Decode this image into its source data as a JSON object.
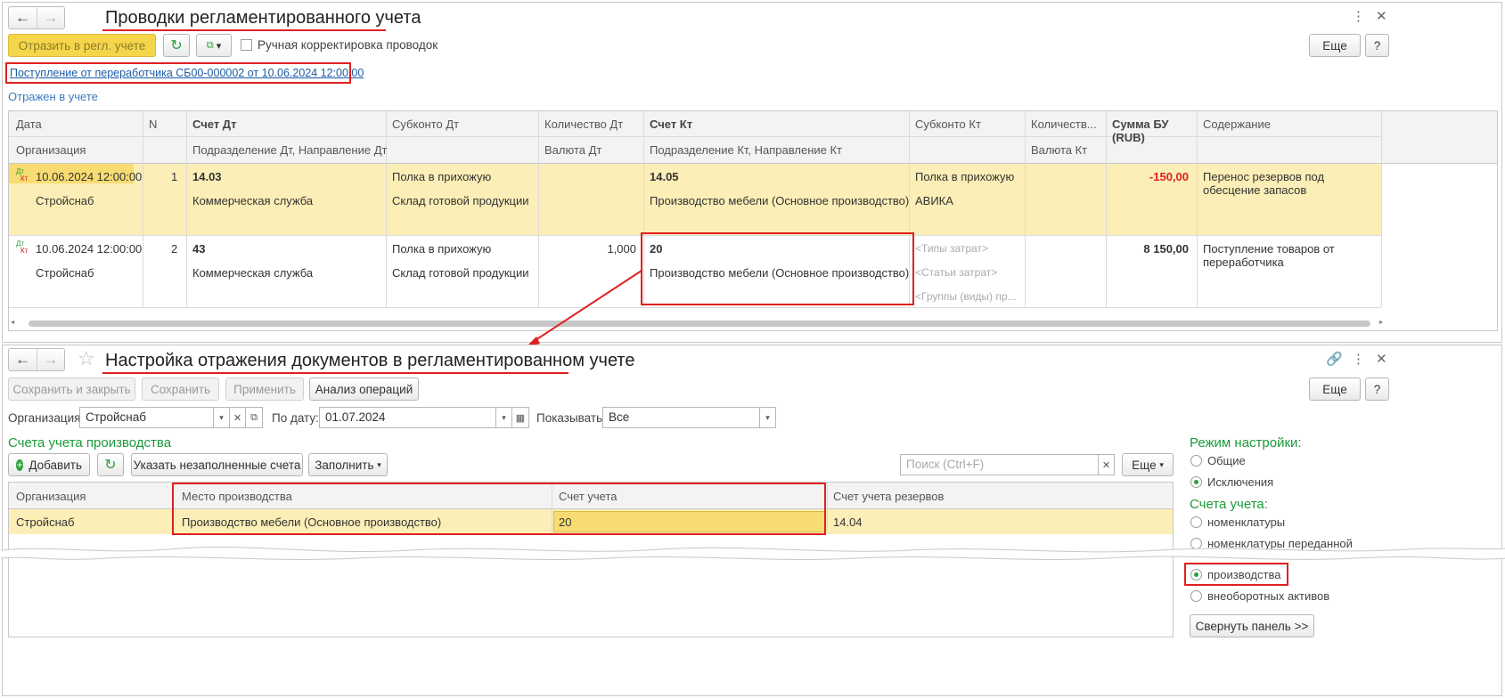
{
  "top": {
    "title": "Проводки регламентированного учета",
    "reflect_button": "Отразить в регл. учете",
    "manual_label": "Ручная корректировка проводок",
    "more_button": "Еще",
    "help_button": "?",
    "doc_link": "Поступление от переработчика СБ00-000002 от 10.06.2024 12:00:00",
    "status": "Отражен в учете",
    "headers": {
      "date": "Дата",
      "n": "N",
      "acc_dt": "Счет Дт",
      "sub_dt": "Субконто Дт",
      "qty_dt": "Количество Дт",
      "acc_kt": "Счет Кт",
      "sub_kt": "Субконто Кт",
      "qty_kt": "Количеств...",
      "sum": "Сумма БУ\n(RUB)",
      "content": "Содержание",
      "org": "Организация",
      "dept_dt": "Подразделение Дт, Направление Дт",
      "cur_dt": "Валюта Дт",
      "dept_kt": "Подразделение Кт, Направление Кт",
      "cur_kt": "Валюта Кт"
    },
    "rows": [
      {
        "dt": "Дт",
        "kt": "Кт",
        "date": "10.06.2024 12:00:00",
        "n": "1",
        "org": "Стройснаб",
        "acc_dt": "14.03",
        "dept_dt": "Коммерческая служба",
        "sub_dt1": "Полка в прихожую",
        "sub_dt2": "Склад готовой продукции",
        "qty_dt": "",
        "acc_kt": "14.05",
        "dept_kt": "Производство мебели (Основное производство)",
        "sub_kt1": "Полка в прихожую",
        "sub_kt2": "АВИКА",
        "sub_kt3": "",
        "sum": "-150,00",
        "content": "Перенос резервов под\nобесцение запасов"
      },
      {
        "dt": "Дт",
        "kt": "Кт",
        "date": "10.06.2024 12:00:00",
        "n": "2",
        "org": "Стройснаб",
        "acc_dt": "43",
        "dept_dt": "Коммерческая служба",
        "sub_dt1": "Полка в прихожую",
        "sub_dt2": "Склад готовой продукции",
        "qty_dt": "1,000",
        "acc_kt": "20",
        "dept_kt": "Производство мебели (Основное производство)",
        "sub_kt1": "<Типы затрат>",
        "sub_kt2": "<Статьи затрат>",
        "sub_kt3": "<Группы (виды) пр...",
        "sum": "8 150,00",
        "content": "Поступление товаров от\nпереработчика"
      }
    ]
  },
  "bottom": {
    "title": "Настройка отражения документов в регламентированном учете",
    "save_close": "Сохранить и закрыть",
    "save": "Сохранить",
    "apply": "Применить",
    "analysis": "Анализ операций",
    "more_button": "Еще",
    "help_button": "?",
    "org_label": "Организация:",
    "org_value": "Стройснаб",
    "date_label": "По дату:",
    "date_value": "01.07.2024",
    "show_label": "Показывать:",
    "show_value": "Все",
    "section_title": "Счета учета производства",
    "add_button": "Добавить",
    "specify_button": "Указать незаполненные счета",
    "fill_button": "Заполнить",
    "search_placeholder": "Поиск (Ctrl+F)",
    "more2_button": "Еще",
    "headers": {
      "org": "Организация",
      "place": "Место производства",
      "account": "Счет учета",
      "reserve": "Счет учета резервов"
    },
    "rows": [
      {
        "org": "Стройснаб",
        "place": "Производство мебели (Основное производство)",
        "account": "20",
        "reserve": "14.04"
      }
    ],
    "mode_title": "Режим настройки:",
    "mode_general": "Общие",
    "mode_exceptions": "Исключения",
    "accounts_title": "Счета учета:",
    "acc_nomen": "номенклатуры",
    "acc_nomen_passed": "номенклатуры переданной",
    "acc_production": "производства",
    "acc_fixed": "внеоборотных активов",
    "collapse_button": "Свернуть панель >>"
  }
}
